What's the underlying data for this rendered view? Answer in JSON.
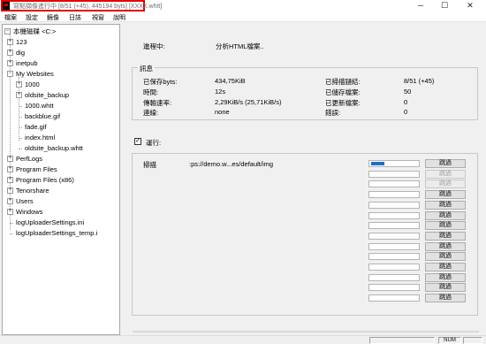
{
  "window": {
    "title": "寫點擷像進行中 [8/51 (+45), 445194 byts]",
    "title_project": "[XXXX.whtt]",
    "minimize_glyph": "─",
    "maximize_glyph": "☐",
    "close_glyph": "✕"
  },
  "menu": [
    "檔案",
    "設定",
    "鏡像",
    "日誌",
    "視窗",
    "說明"
  ],
  "tree": {
    "root": "本機磁碟 <C:>",
    "items": [
      {
        "label": "123"
      },
      {
        "label": "dig"
      },
      {
        "label": "inetpub"
      },
      {
        "label": "My Websites"
      },
      {
        "label": "1000"
      },
      {
        "label": "oldsite_backup"
      },
      {
        "label": "1000.whtt"
      },
      {
        "label": "backblue.gif"
      },
      {
        "label": "fade.gif"
      },
      {
        "label": "index.html"
      },
      {
        "label": "oldsite_backup.whtt"
      },
      {
        "label": "PerfLogs"
      },
      {
        "label": "Program Files"
      },
      {
        "label": "Program Files (x86)"
      },
      {
        "label": "Tenorshare"
      },
      {
        "label": "Users"
      },
      {
        "label": "Windows"
      },
      {
        "label": "logUploaderSettings.ini"
      },
      {
        "label": "logUploaderSettings_temp.i"
      }
    ],
    "expand_glyph": "+",
    "collapse_glyph": "−"
  },
  "progress": {
    "phase_label": "進程中:",
    "phase_value": "分析HTML檔案..",
    "info_title": "訊息",
    "info": {
      "saved_bytes_label": "已保存byts:",
      "saved_bytes_value": "434,75KiB",
      "time_label": "時間:",
      "time_value": "12s",
      "rate_label": "傳輸速率:",
      "rate_value": "2,29KiB/s (25,71KiB/s)",
      "conn_label": "連線:",
      "conn_value": "none",
      "scanned_links_label": "已掃描鏈結:",
      "scanned_links_value": "8/51 (+45)",
      "stored_files_label": "已儲存檔案:",
      "stored_files_value": "50",
      "updated_files_label": "已更新檔案:",
      "updated_files_value": "0",
      "errors_label": "錯誤:",
      "errors_value": "0"
    },
    "running_label": "運行:",
    "running_check": "✓",
    "scan_label": "掃描",
    "scan_url": ":ps://demo.w...es/default/img",
    "skip_label": "跳過",
    "slot_fill": [
      0.28,
      0,
      0,
      0,
      0,
      0,
      0,
      0,
      0,
      0,
      0,
      0,
      0,
      0
    ],
    "slot_enabled": [
      true,
      false,
      false,
      true,
      true,
      true,
      true,
      true,
      true,
      true,
      true,
      true,
      true,
      true
    ]
  },
  "statusbar": {
    "num": "NUM"
  }
}
